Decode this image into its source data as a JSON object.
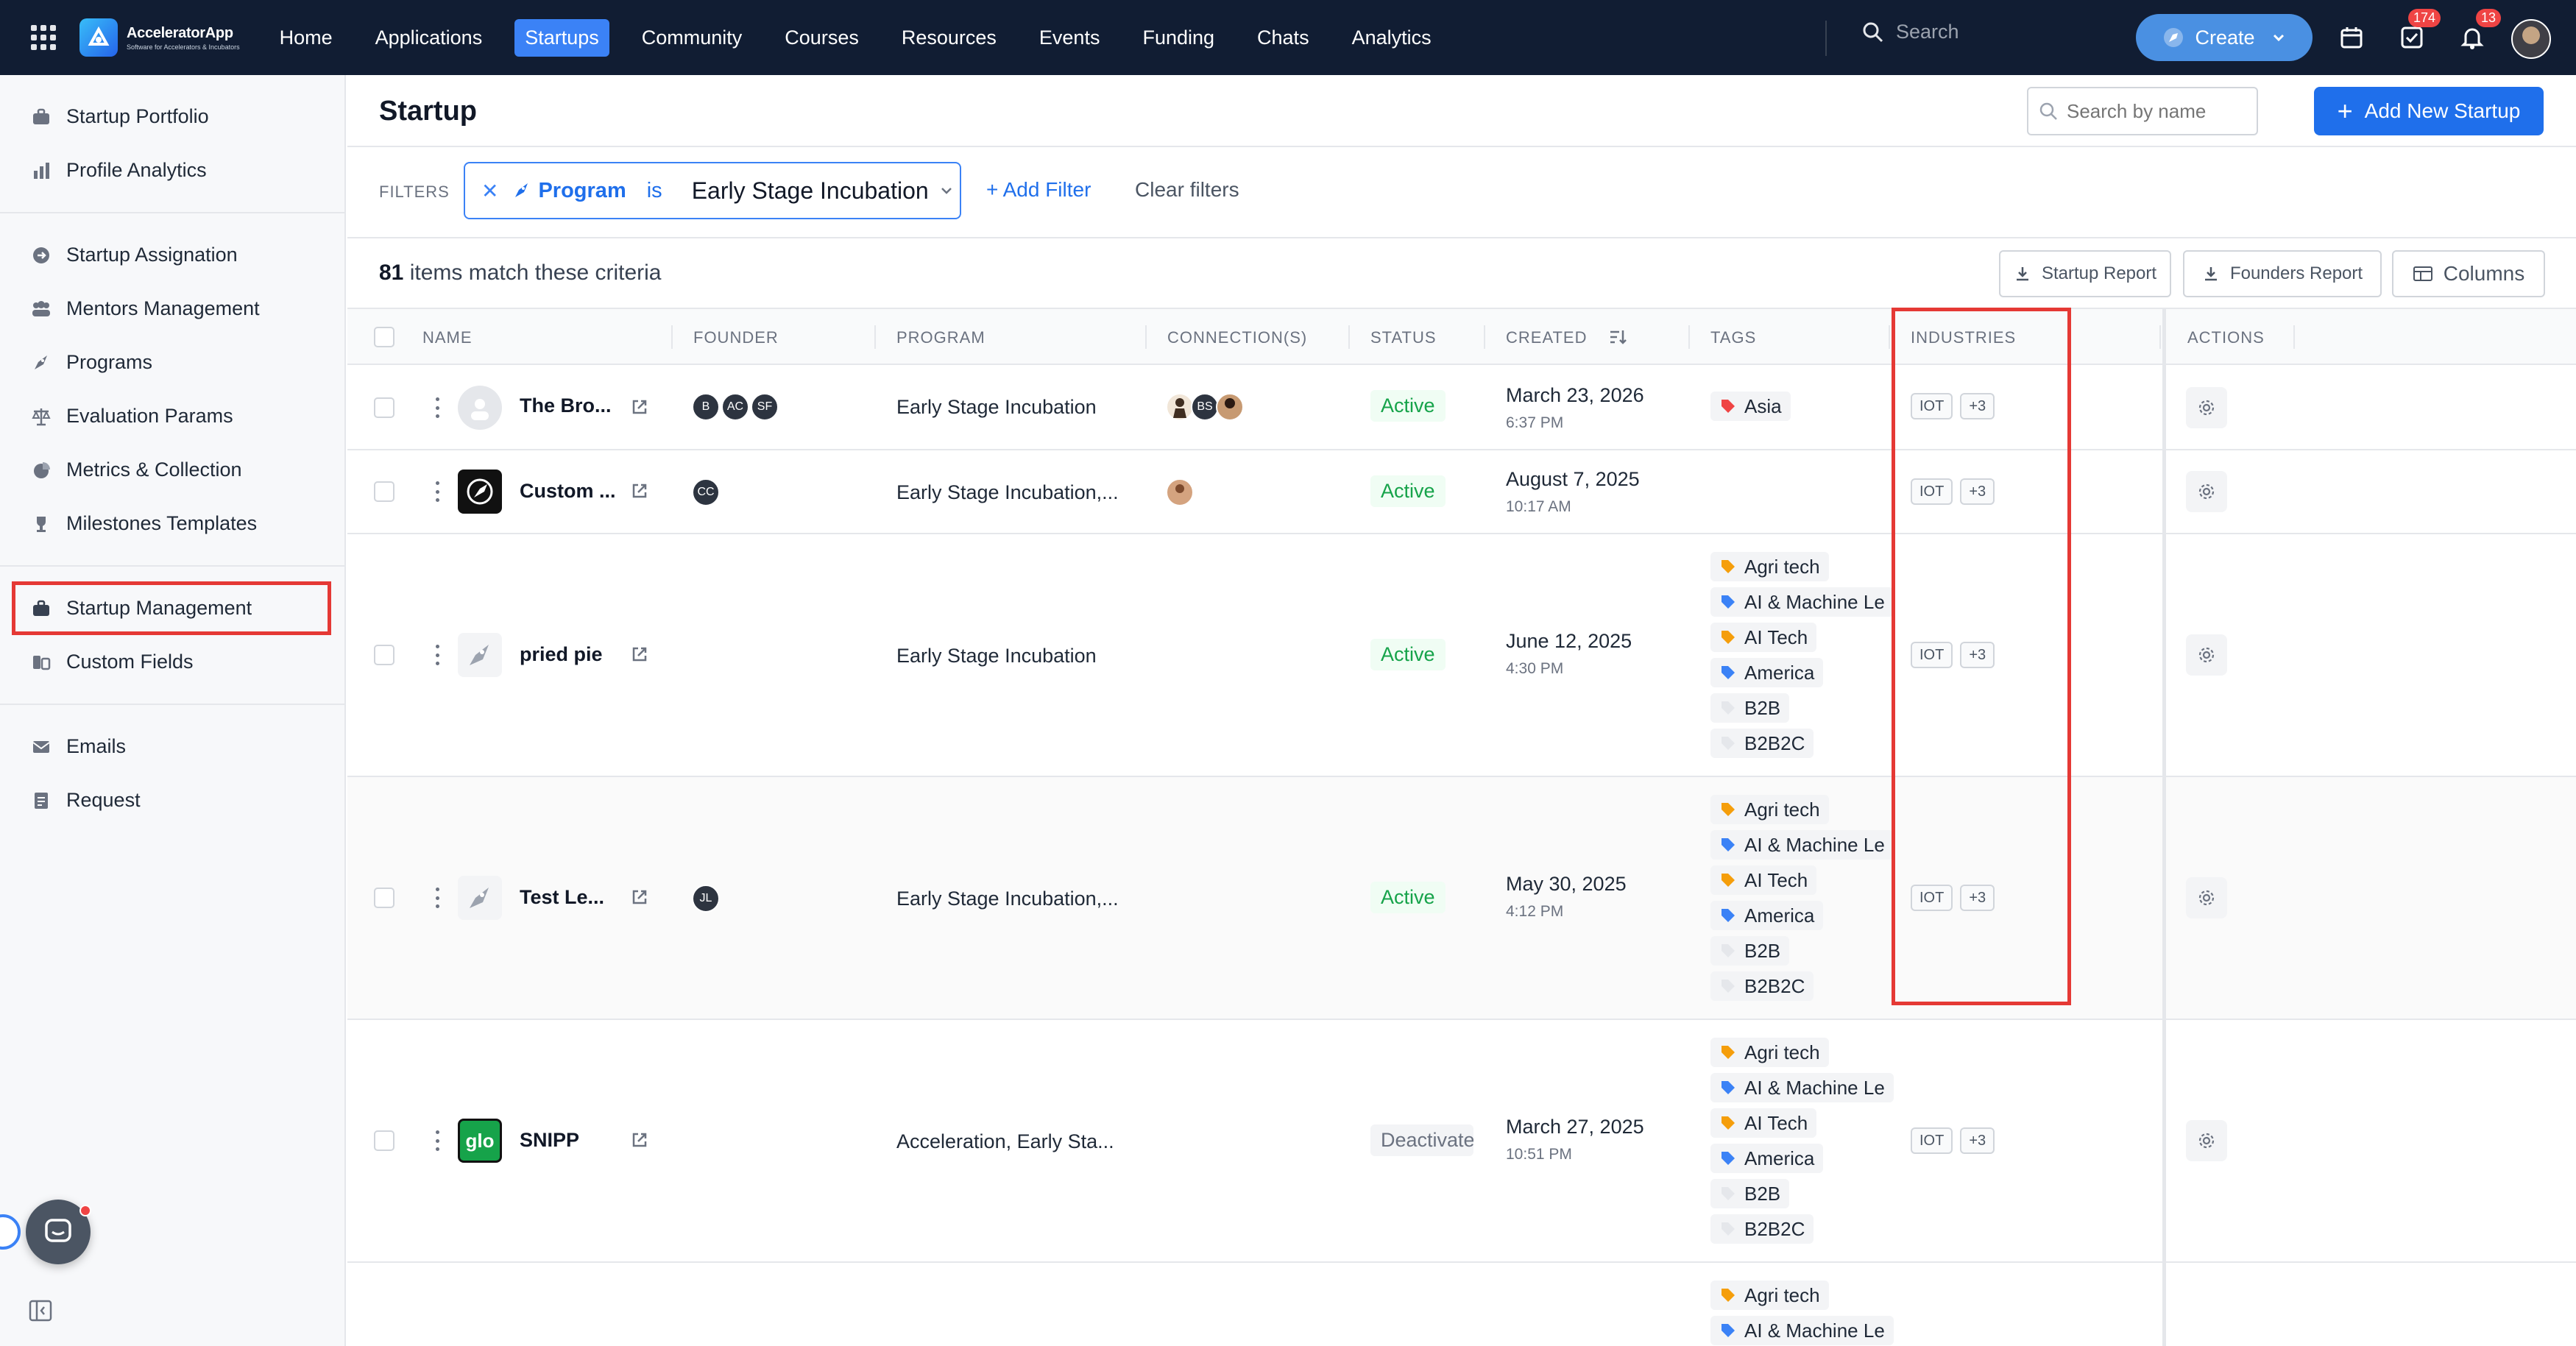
{
  "app": {
    "name": "AcceleratorApp",
    "tagline": "Software for Accelerators & Incubators"
  },
  "nav": {
    "items": [
      "Home",
      "Applications",
      "Startups",
      "Community",
      "Courses",
      "Resources",
      "Events",
      "Funding",
      "Chats",
      "Analytics"
    ],
    "active": "Startups",
    "search_label": "Search",
    "create_label": "Create",
    "tasks_badge": "174",
    "notifications_badge": "13"
  },
  "sidebar": {
    "group1": [
      "Startup Portfolio",
      "Profile Analytics"
    ],
    "group2": [
      "Startup Assignation",
      "Mentors Management",
      "Programs",
      "Evaluation Params",
      "Metrics & Collection",
      "Milestones Templates"
    ],
    "group3": [
      "Startup Management",
      "Custom Fields"
    ],
    "group4": [
      "Emails",
      "Request"
    ],
    "highlighted": "Startup Management"
  },
  "page": {
    "title": "Startup",
    "search_placeholder": "Search by name",
    "add_button": "Add New Startup"
  },
  "filters": {
    "label": "FILTERS",
    "chip_field": "Program",
    "chip_operator": "is",
    "chip_value": "Early Stage Incubation",
    "add_filter": "Add Filter",
    "clear_filters": "Clear filters"
  },
  "results": {
    "count": "81",
    "count_suffix": "items match these criteria",
    "startup_report": "Startup Report",
    "founders_report": "Founders Report",
    "columns": "Columns"
  },
  "table": {
    "headers": {
      "name": "NAME",
      "founder": "FOUNDER",
      "program": "PROGRAM",
      "connections": "CONNECTION(S)",
      "status": "STATUS",
      "created": "CREATED",
      "tags": "TAGS",
      "industries": "INDUSTRIES",
      "actions": "ACTIONS"
    },
    "rows": [
      {
        "name": "The Bro...",
        "founders": [
          "B",
          "AC",
          "SF"
        ],
        "program": "Early Stage Incubation",
        "connections": [
          "",
          "BS",
          ""
        ],
        "status": "Active",
        "date": "March 23, 2026",
        "time": "6:37 PM",
        "tags": [
          "Asia"
        ],
        "industry": "IOT",
        "more": "+3"
      },
      {
        "name": "Custom ...",
        "founders": [
          "CC"
        ],
        "program": "Early Stage Incubation,...",
        "connections": [
          ""
        ],
        "status": "Active",
        "date": "August 7, 2025",
        "time": "10:17 AM",
        "tags": [],
        "industry": "IOT",
        "more": "+3"
      },
      {
        "name": "pried pie",
        "founders": [],
        "program": "Early Stage Incubation",
        "connections": [],
        "status": "Active",
        "date": "June 12, 2025",
        "time": "4:30 PM",
        "tags": [
          "Agri tech",
          "AI & Machine Le",
          "AI Tech",
          "America",
          "B2B",
          "B2B2C"
        ],
        "industry": "IOT",
        "more": "+3"
      },
      {
        "name": "Test Le...",
        "founders": [
          "JL"
        ],
        "program": "Early Stage Incubation,...",
        "connections": [],
        "status": "Active",
        "date": "May 30, 2025",
        "time": "4:12 PM",
        "tags": [
          "Agri tech",
          "AI & Machine Le",
          "AI Tech",
          "America",
          "B2B",
          "B2B2C"
        ],
        "industry": "IOT",
        "more": "+3"
      },
      {
        "name": "SNIPP",
        "founders": [],
        "program": "Acceleration, Early Sta...",
        "connections": [],
        "status": "Deactivated",
        "date": "March 27, 2025",
        "time": "10:51 PM",
        "tags": [
          "Agri tech",
          "AI & Machine Le",
          "AI Tech",
          "America",
          "B2B",
          "B2B2C"
        ],
        "industry": "IOT",
        "more": "+3"
      },
      {
        "name": "",
        "founders": [],
        "program": "",
        "connections": [],
        "status": "",
        "date": "",
        "time": "",
        "tags": [
          "Agri tech",
          "AI & Machine Le"
        ],
        "industry": "",
        "more": ""
      }
    ],
    "snipp_logo_text": "glo"
  },
  "colors": {
    "nav_bg": "#111d33",
    "accent": "#1f6feb",
    "active_status": "#16a34a",
    "highlight": "#e53935"
  }
}
